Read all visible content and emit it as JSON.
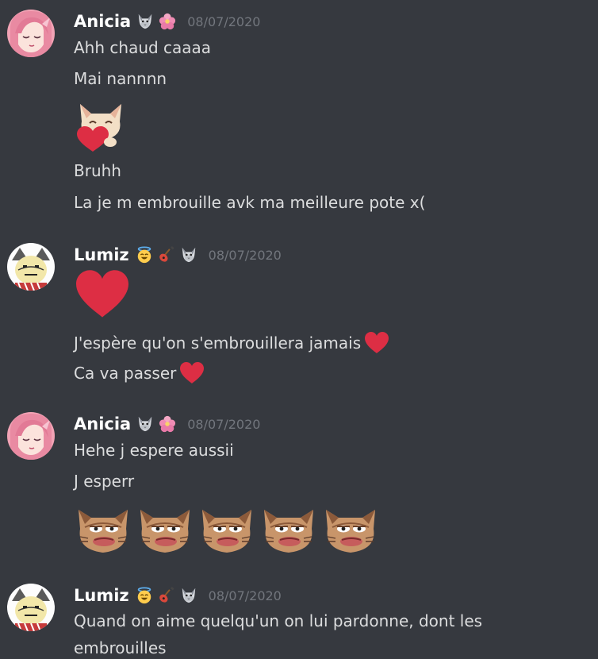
{
  "messages": [
    {
      "author": "Anicia",
      "timestamp": "08/07/2020",
      "badges": [
        "wolf-icon",
        "flower-icon"
      ],
      "lines": [
        "Ahh chaud caaaa",
        "Mai nannnn",
        "Bruhh",
        "La je m embrouille avk ma meilleure pote x("
      ],
      "emotes": [
        "cat-heart-emote"
      ]
    },
    {
      "author": "Lumiz",
      "timestamp": "08/07/2020",
      "badges": [
        "halo-smiley-icon",
        "guitar-icon",
        "wolf-icon"
      ],
      "lines": [
        "J'espère qu'on s'embrouillera jamais",
        "Ca va passer"
      ],
      "emotes": [
        "heart-emote"
      ]
    },
    {
      "author": "Anicia",
      "timestamp": "08/07/2020",
      "badges": [
        "wolf-icon",
        "flower-icon"
      ],
      "lines": [
        "Hehe j espere aussii",
        "J esperr"
      ],
      "emotes": [
        "pepe-cat-emote",
        "pepe-cat-emote",
        "pepe-cat-emote",
        "pepe-cat-emote",
        "pepe-cat-emote"
      ]
    },
    {
      "author": "Lumiz",
      "timestamp": "08/07/2020",
      "badges": [
        "halo-smiley-icon",
        "guitar-icon",
        "wolf-icon"
      ],
      "lines": [
        "Quand on aime quelqu'un on lui pardonne, dont les embrouilles"
      ]
    }
  ],
  "colors": {
    "background": "#36393f",
    "username": "#ffffff",
    "text": "#dcddde",
    "timestamp": "#72767d",
    "heart": "#dd2e44"
  }
}
